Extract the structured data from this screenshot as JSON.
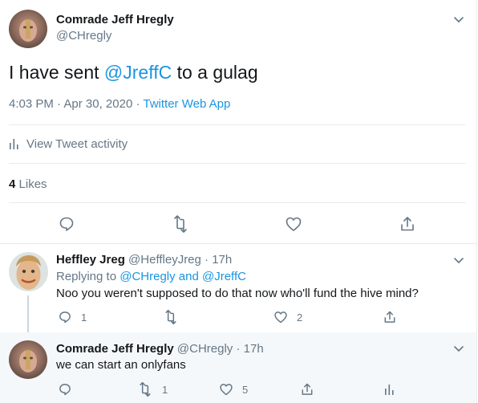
{
  "main_tweet": {
    "display_name": "Comrade Jeff Hregly",
    "handle": "@CHregly",
    "text_before": "I have sent ",
    "mention": "@JreffC",
    "text_after": " to a gulag",
    "time": "4:03 PM",
    "dot1": "·",
    "date": "Apr 30, 2020",
    "dot2": "·",
    "source": "Twitter Web App",
    "activity_label": "View Tweet activity",
    "likes_count": "4",
    "likes_label": "Likes"
  },
  "reply1": {
    "display_name": "Heffley Jreg",
    "handle": "@HeffleyJreg",
    "dot": "·",
    "age": "17h",
    "replying_prefix": "Replying to",
    "replying_targets": "@CHregly and @JreffC",
    "text": "Noo you weren't supposed to do that now who'll fund the hive mind?",
    "reply_count": "1",
    "retweet_count": "",
    "like_count": "2"
  },
  "reply2": {
    "display_name": "Comrade Jeff Hregly",
    "handle": "@CHregly",
    "dot": "·",
    "age": "17h",
    "text": "we can start an onlyfans",
    "reply_count": "",
    "retweet_count": "1",
    "like_count": "5"
  },
  "colors": {
    "accent": "#1b95e0",
    "muted": "#657786",
    "thread_line": "#ccd6dd",
    "highlight_bg": "#f5f8fa"
  },
  "icons": [
    "chevron-down-icon",
    "reply-icon",
    "retweet-icon",
    "like-icon",
    "share-icon",
    "analytics-icon"
  ]
}
